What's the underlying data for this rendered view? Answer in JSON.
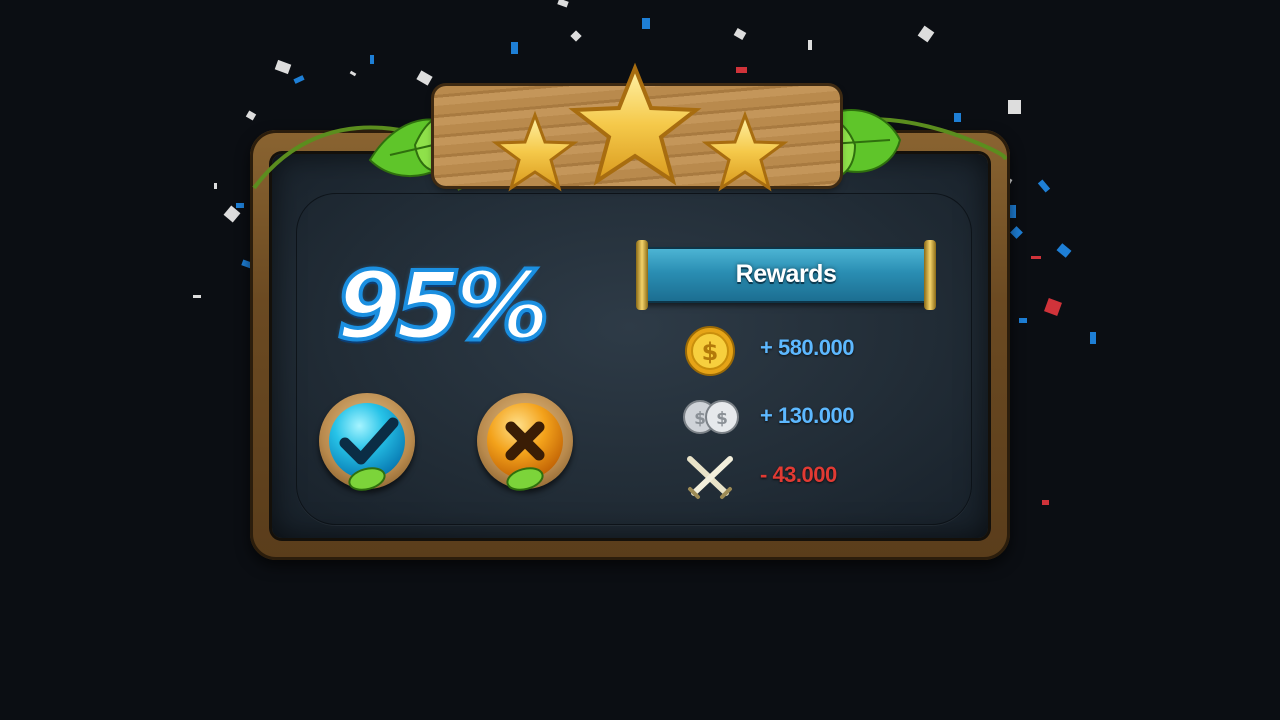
{
  "result": {
    "percent_text": "95%",
    "stars_earned": 3,
    "stars_total": 3
  },
  "actions": {
    "confirm_icon": "checkmark-icon",
    "close_icon": "cross-icon"
  },
  "rewards": {
    "title": "Rewards",
    "items": [
      {
        "icon": "gold-coin-icon",
        "value": "+ 580.000",
        "kind": "positive"
      },
      {
        "icon": "silver-coins-icon",
        "value": "+ 130.000",
        "kind": "positive"
      },
      {
        "icon": "crossed-swords-icon",
        "value": "- 43.000",
        "kind": "negative"
      }
    ]
  },
  "colors": {
    "background": "#0b0e13",
    "positive": "#5db8ff",
    "negative": "#e23a33",
    "banner": "#2a8eb3",
    "star": "#f5c94a"
  }
}
